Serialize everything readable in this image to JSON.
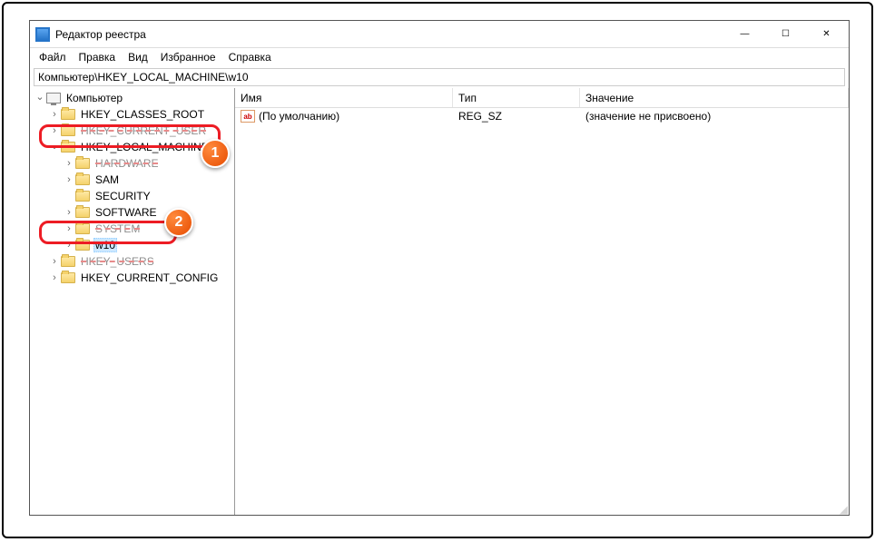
{
  "window": {
    "title": "Редактор реестра",
    "controls": {
      "min": "—",
      "max": "☐",
      "close": "✕"
    }
  },
  "menu": {
    "file": "Файл",
    "edit": "Правка",
    "view": "Вид",
    "favorites": "Избранное",
    "help": "Справка"
  },
  "addressbar": "Компьютер\\HKEY_LOCAL_MACHINE\\w10",
  "tree": {
    "root": "Компьютер",
    "items": [
      {
        "label": "HKEY_CLASSES_ROOT",
        "indent": 1,
        "exp": "collapsed"
      },
      {
        "label": "HKEY_CURRENT_USER",
        "indent": 1,
        "exp": "collapsed",
        "obscured": true,
        "strike": true
      },
      {
        "label": "HKEY_LOCAL_MACHINE",
        "indent": 1,
        "exp": "expanded"
      },
      {
        "label": "HARDWARE",
        "indent": 2,
        "exp": "collapsed",
        "obscured": true,
        "strike": true
      },
      {
        "label": "SAM",
        "indent": 2,
        "exp": "collapsed"
      },
      {
        "label": "SECURITY",
        "indent": 2,
        "exp": "none"
      },
      {
        "label": "SOFTWARE",
        "indent": 2,
        "exp": "collapsed"
      },
      {
        "label": "SYSTEM",
        "indent": 2,
        "exp": "collapsed",
        "obscured": true,
        "strike": true
      },
      {
        "label": "w10",
        "indent": 2,
        "exp": "collapsed",
        "selected": true
      },
      {
        "label": "HKEY_USERS",
        "indent": 1,
        "exp": "collapsed",
        "obscured": true,
        "strike": true
      },
      {
        "label": "HKEY_CURRENT_CONFIG",
        "indent": 1,
        "exp": "collapsed"
      }
    ]
  },
  "list": {
    "headers": {
      "name": "Имя",
      "type": "Тип",
      "value": "Значение"
    },
    "rows": [
      {
        "name": "(По умолчанию)",
        "type": "REG_SZ",
        "value": "(значение не присвоено)"
      }
    ],
    "icon_label": "ab"
  },
  "badges": {
    "b1": "1",
    "b2": "2"
  }
}
